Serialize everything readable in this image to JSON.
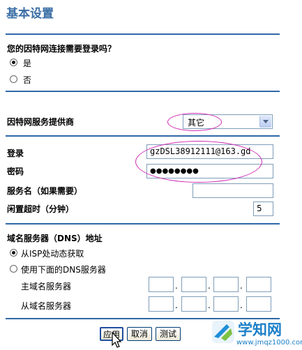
{
  "page": {
    "title": "基本设置"
  },
  "login_required": {
    "question": "您的因特网连接需要登录吗？",
    "options": [
      {
        "label": "是",
        "selected": true
      },
      {
        "label": "否",
        "selected": false
      }
    ]
  },
  "isp": {
    "label": "因特网服务提供商",
    "selected": "其它"
  },
  "account": {
    "login_label": "登录",
    "login_value": "gzDSL38912111@163.gd",
    "password_label": "密码",
    "password_value": "●●●●●●●●",
    "service_label": "服务名（如果需要）",
    "service_value": "",
    "idle_label": "闲置超时（分钟）",
    "idle_value": "5"
  },
  "dns": {
    "heading": "域名服务器（DNS）地址",
    "options": [
      {
        "label": "从ISP处动态获取",
        "selected": true
      },
      {
        "label": "使用下面的DNS服务器",
        "selected": false
      }
    ],
    "primary_label": "主域名服务器",
    "secondary_label": "从域名服务器",
    "separator": "."
  },
  "buttons": {
    "apply": "应用",
    "cancel": "取消",
    "test": "测试"
  },
  "watermark": {
    "brand": "学知网",
    "url": "www.jmqz1000.com"
  },
  "colors": {
    "title": "#3a6ea5",
    "rule": "#2f68a8",
    "highlight_oval": "#d02ab5"
  }
}
